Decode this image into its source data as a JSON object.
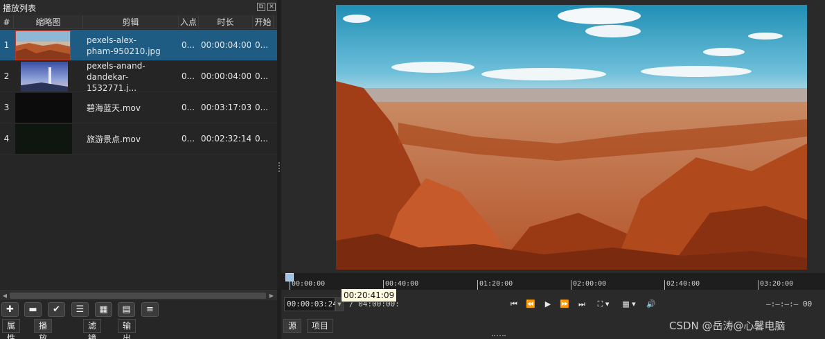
{
  "playlist": {
    "title": "播放列表",
    "columns": [
      "#",
      "缩略图",
      "剪辑",
      "入点",
      "时长",
      "开始"
    ],
    "rows": [
      {
        "num": "1",
        "name": "pexels-alex-\npham-950210.jpg",
        "in": "0...",
        "duration": "00:00:04:00",
        "start": "0...",
        "thumb": "desert"
      },
      {
        "num": "2",
        "name": "pexels-anand-\ndandekar-1532771.j...",
        "in": "0...",
        "duration": "00:00:04:00",
        "start": "0...",
        "thumb": "lighthouse"
      },
      {
        "num": "3",
        "name": "碧海蓝天.mov",
        "in": "0...",
        "duration": "00:03:17:03",
        "start": "0...",
        "thumb": "dark"
      },
      {
        "num": "4",
        "name": "旅游景点.mov",
        "in": "0...",
        "duration": "00:02:32:14",
        "start": "0...",
        "thumb": "dark-green"
      }
    ],
    "toolbar_icons": [
      "add-icon",
      "remove-icon",
      "check-icon",
      "list-view-icon",
      "grid-view-icon",
      "details-view-icon",
      "menu-icon"
    ],
    "tabs": [
      "属性",
      "播放列表",
      "滤镜",
      "输出"
    ],
    "active_tab": "播放列表"
  },
  "viewer": {
    "ruler_ticks": [
      "00:00:00",
      "00:40:00",
      "01:20:00",
      "02:00:00",
      "02:40:00",
      "03:20:00"
    ],
    "tooltip": "00:20:41:09",
    "current_timecode": "00:00:03:24",
    "total_timecode": "/ 04:00:00:",
    "transport_icons": [
      "skip-start-icon",
      "rewind-icon",
      "play-icon",
      "fast-forward-icon",
      "skip-end-icon",
      "zoom-icon",
      "grid-icon",
      "volume-icon"
    ],
    "right_timecode": "—:—:—:— 00",
    "tabs": [
      "源",
      "项目"
    ],
    "active_tab": "源"
  },
  "watermark": "CSDN @岳涛@心馨电脑",
  "colors": {
    "selection": "#1f5c84",
    "background": "#232323"
  }
}
